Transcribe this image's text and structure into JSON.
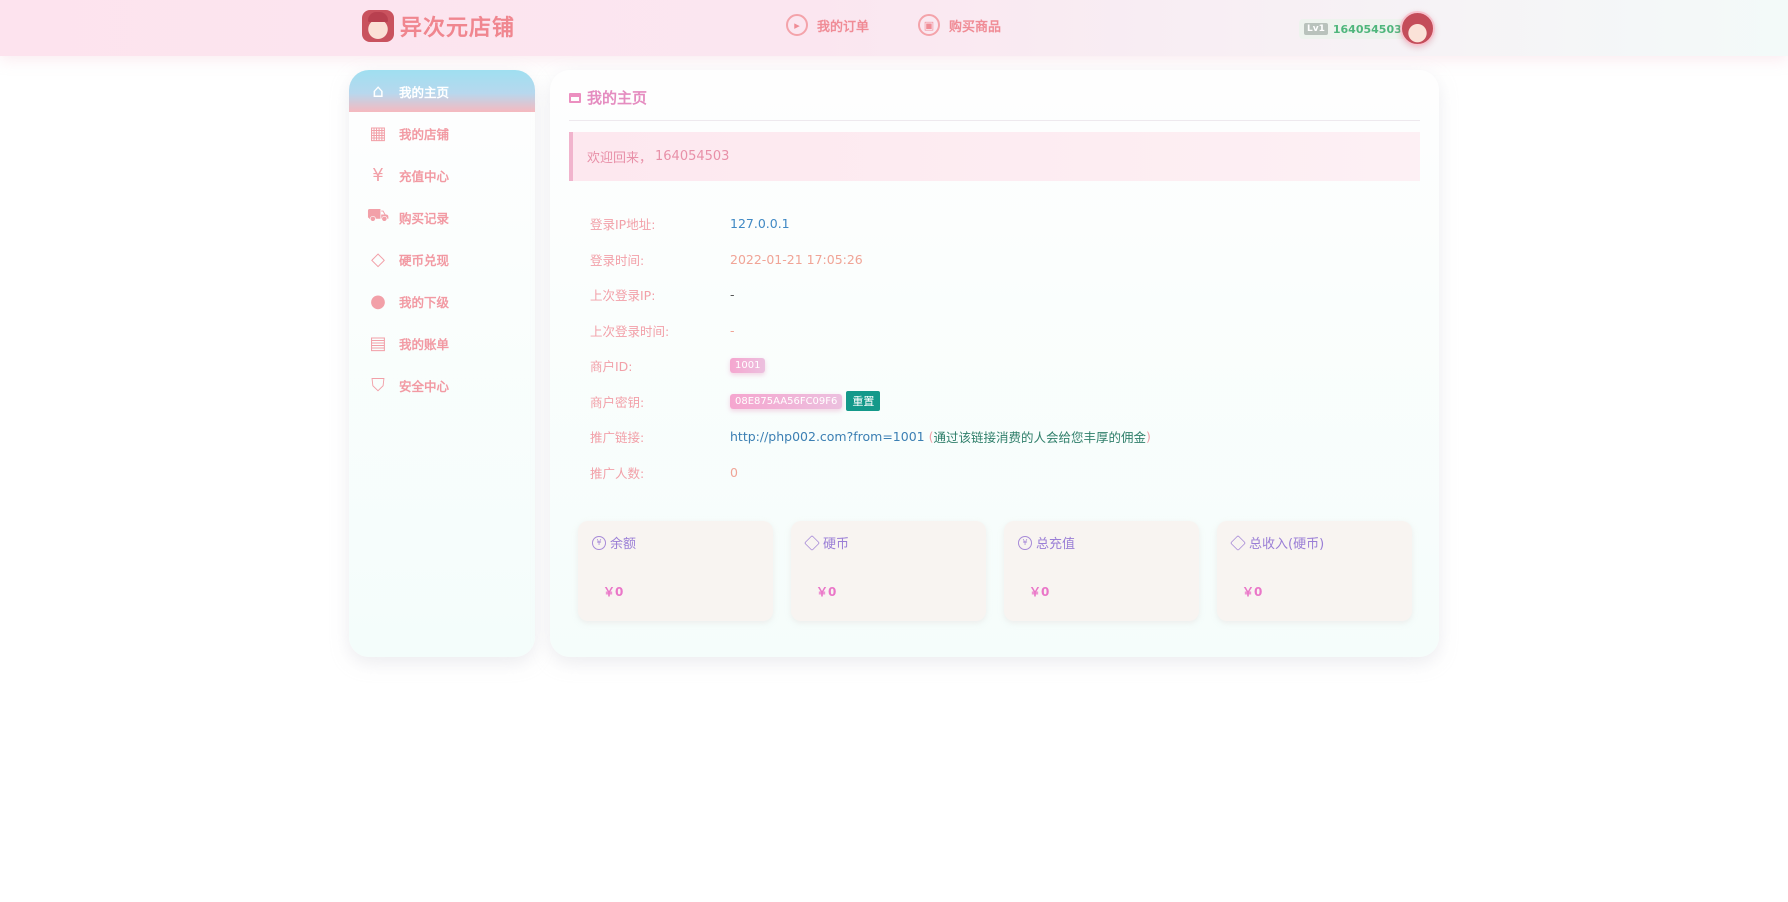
{
  "header": {
    "brand": "异次元店铺",
    "nav": [
      {
        "label": "我的订单",
        "icon": "order-icon"
      },
      {
        "label": "购买商品",
        "icon": "shop-icon"
      }
    ],
    "level_badge": "Lv1",
    "username": "164054503"
  },
  "sidebar": {
    "items": [
      {
        "label": "我的主页",
        "icon": "home-icon",
        "active": true
      },
      {
        "label": "我的店铺",
        "icon": "store-icon"
      },
      {
        "label": "充值中心",
        "icon": "yen-icon"
      },
      {
        "label": "购买记录",
        "icon": "cart-icon"
      },
      {
        "label": "硬币兑现",
        "icon": "diamond-icon"
      },
      {
        "label": "我的下级",
        "icon": "user-icon"
      },
      {
        "label": "我的账单",
        "icon": "clipboard-icon"
      },
      {
        "label": "安全中心",
        "icon": "shield-icon"
      }
    ]
  },
  "main": {
    "title": "我的主页",
    "welcome_prefix": "欢迎回来，",
    "welcome_name": "164054503",
    "info": {
      "login_ip_label": "登录IP地址:",
      "login_ip": "127.0.0.1",
      "login_time_label": "登录时间:",
      "login_time": "2022-01-21 17:05:26",
      "last_ip_label": "上次登录IP:",
      "last_ip": "-",
      "last_time_label": "上次登录时间:",
      "last_time": "-",
      "merchant_id_label": "商户ID:",
      "merchant_id": "1001",
      "merchant_key_label": "商户密钥:",
      "merchant_key": "08E875AA56FC09F6",
      "reset_label": "重置",
      "promo_link_label": "推广链接:",
      "promo_link": "http://php002.com?from=1001",
      "promo_note": "通过该链接消费的人会给您丰厚的佣金",
      "promo_count_label": "推广人数:",
      "promo_count": "0"
    },
    "cards": [
      {
        "label": "余额",
        "value": "￥0",
        "icon": "yen-icon"
      },
      {
        "label": "硬币",
        "value": "￥0",
        "icon": "diamond-icon"
      },
      {
        "label": "总充值",
        "value": "￥0",
        "icon": "yen-icon"
      },
      {
        "label": "总收入(硬币)",
        "value": "￥0",
        "icon": "diamond-icon"
      }
    ]
  },
  "colors": {
    "accent_pink": "#f29aa3",
    "value_purple": "#ea76c8",
    "reset_green": "#14998a",
    "link_blue": "#3b7fb3"
  }
}
